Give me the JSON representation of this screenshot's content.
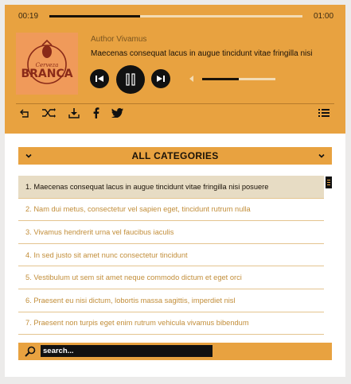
{
  "player": {
    "current_time": "00:19",
    "duration": "01:00",
    "progress_fraction": 0.36,
    "volume_fraction": 0.5,
    "cover": {
      "brand": "BRANCA",
      "script": "Cerveza"
    },
    "author": "Author Vivamus",
    "track_title": "Maecenas consequat lacus in augue tincidunt vitae fringilla nisi",
    "controls": [
      "prev-icon",
      "pause-icon",
      "next-icon",
      "volume-icon"
    ],
    "toolbar_icons": [
      "undo-icon",
      "shuffle-icon",
      "download-icon",
      "facebook-icon",
      "twitter-icon",
      "playlist-icon"
    ]
  },
  "categories": {
    "title": "ALL CATEGORIES"
  },
  "playlist": {
    "active_index": 0,
    "items": [
      "1. Maecenas consequat lacus in augue tincidunt vitae fringilla nisi posuere",
      "2. Nam dui metus, consectetur vel sapien eget, tincidunt rutrum nulla",
      "3. Vivamus hendrerit urna vel faucibus iaculis",
      "4. In sed justo sit amet nunc consectetur tincidunt",
      "5. Vestibulum ut sem sit amet neque commodo dictum et eget orci",
      "6. Praesent eu nisi dictum, lobortis massa sagittis, imperdiet nisl",
      "7. Praesent non turpis eget enim rutrum vehicula vivamus bibendum"
    ]
  },
  "search": {
    "placeholder": "search..."
  },
  "colors": {
    "accent": "#e8a240",
    "active_row": "#e7dcc4",
    "inactive_text": "#c28e3a",
    "dark": "#111111"
  }
}
